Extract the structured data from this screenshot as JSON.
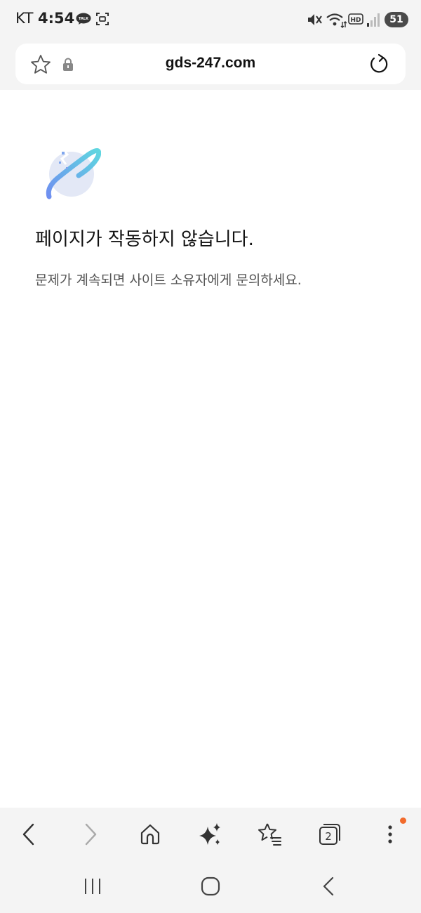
{
  "status_bar": {
    "carrier": "KT",
    "time": "4:54",
    "talk_badge": "TALK",
    "hd_label": "HD",
    "battery_level": "51",
    "icons": [
      "kakaotalk-icon",
      "screen-capture-icon",
      "mute-icon",
      "wifi-icon",
      "hd-voice-icon",
      "signal-icon",
      "battery-icon"
    ]
  },
  "address_bar": {
    "url": "gds-247.com",
    "icons": [
      "bookmark-star-icon",
      "lock-icon",
      "reload-icon"
    ]
  },
  "error_page": {
    "title": "페이지가 작동하지 않습니다.",
    "description": "문제가 계속되면 사이트 소유자에게 문의하세요."
  },
  "toolbar": {
    "tabs_count": "2",
    "items": [
      "back",
      "forward",
      "home",
      "ai-assistant",
      "bookmarks",
      "tabs",
      "menu"
    ]
  },
  "colors": {
    "chrome_bg": "#f4f4f4",
    "page_bg": "#ffffff",
    "accent_orange": "#f26a2b",
    "illustration_blue": "#6f8ff0",
    "illustration_cyan": "#5fd6e0"
  }
}
